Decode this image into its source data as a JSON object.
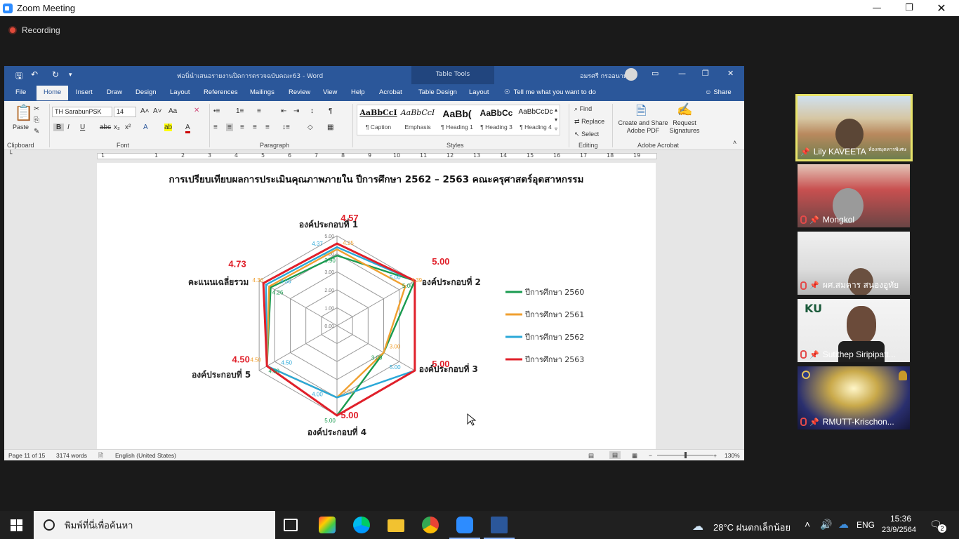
{
  "zoom": {
    "title": "Zoom Meeting",
    "recording_label": "Recording",
    "participants": [
      {
        "name": "Lily KAVEETA",
        "overlay": "ห้องสมุดหารพิเศษ",
        "active": true
      },
      {
        "name": "Mongkol"
      },
      {
        "name": "ผศ.สมคาร สนองอูทัย"
      },
      {
        "name": "Sutithep Siripipatt...",
        "logo": "KU"
      },
      {
        "name": "RMUTT-Krischon..."
      }
    ]
  },
  "word": {
    "doc_title": "ฟอนิ่นำเสนอรายงานปิดการตรวจฉบับคณะ63 - Word",
    "contextual_group": "Table Tools",
    "user_name": "อมรศรี กรออนาม",
    "tabs": [
      "File",
      "Home",
      "Insert",
      "Draw",
      "Design",
      "Layout",
      "References",
      "Mailings",
      "Review",
      "View",
      "Help",
      "Acrobat",
      "Table Design",
      "Layout"
    ],
    "tell_me": "Tell me what you want to do",
    "share": "Share",
    "ribbon": {
      "paste": "Paste",
      "font_name": "TH SarabunPSK",
      "font_size": "14",
      "groups": [
        "Clipboard",
        "Font",
        "Paragraph",
        "Styles",
        "Editing",
        "Adobe Acrobat"
      ],
      "styles": [
        {
          "preview": "AaBbCcI",
          "name": "¶ Caption"
        },
        {
          "preview": "AaBbCcI",
          "name": "Emphasis"
        },
        {
          "preview": "AaBb(",
          "name": "¶ Heading 1"
        },
        {
          "preview": "AaBbCc",
          "name": "¶ Heading 3"
        },
        {
          "preview": "AaBbCcDc",
          "name": "¶ Heading 4"
        }
      ],
      "editing": [
        "Find",
        "Replace",
        "Select"
      ],
      "acrobat_create": "Create and Share Adobe PDF",
      "acrobat_request": "Request Signatures"
    },
    "ruler_marks": [
      "1",
      "1",
      "2",
      "3",
      "4",
      "5",
      "6",
      "7",
      "8",
      "9",
      "10",
      "11",
      "12",
      "13",
      "14",
      "15",
      "16",
      "17",
      "18",
      "19"
    ],
    "status": {
      "page": "Page 11 of 15",
      "words": "3174 words",
      "language": "English (United States)",
      "zoom": "130%"
    }
  },
  "document": {
    "heading": "การเปรียบเทียบผลการประเมินคุณภาพภายใน ปีการศึกษา 2562 – 2563 คณะครุศาสตร์อุตสาหกรรม"
  },
  "chart_data": {
    "type": "radar",
    "axes": [
      "องค์ประกอบที่ 1",
      "องค์ประกอบที่ 2",
      "องค์ประกอบที่ 3",
      "องค์ประกอบที่ 4",
      "องค์ประกอบที่ 5",
      "คะแนนเฉลี่ยรวม"
    ],
    "rlim": [
      0,
      5
    ],
    "grid_labels": [
      "0.00",
      "1.00",
      "2.00",
      "3.00",
      "4.00",
      "5.00"
    ],
    "series": [
      {
        "name": "ปีการศึกษา 2560",
        "color": "#1a9b50",
        "values": [
          3.9,
          5.0,
          3.0,
          5.0,
          4.5,
          4.26
        ]
      },
      {
        "name": "ปีการศึกษา 2561",
        "color": "#f0a030",
        "values": [
          4.25,
          4.39,
          3.0,
          4.0,
          4.5,
          4.36
        ]
      },
      {
        "name": "ปีการศึกษา 2562",
        "color": "#2aa8d8",
        "values": [
          4.37,
          5.0,
          5.0,
          4.0,
          4.5,
          4.56
        ]
      },
      {
        "name": "ปีการศึกษา 2563",
        "color": "#e0202a",
        "values": [
          4.57,
          5.0,
          5.0,
          5.0,
          4.5,
          4.73
        ]
      }
    ],
    "legend_position": "right"
  },
  "taskbar": {
    "search_placeholder": "พิมพ์ที่นี่เพื่อค้นหา",
    "weather": "28°C  ฝนตกเล็กน้อย",
    "language": "ENG",
    "time": "15:36",
    "date": "23/9/2564",
    "notifications": "2"
  }
}
